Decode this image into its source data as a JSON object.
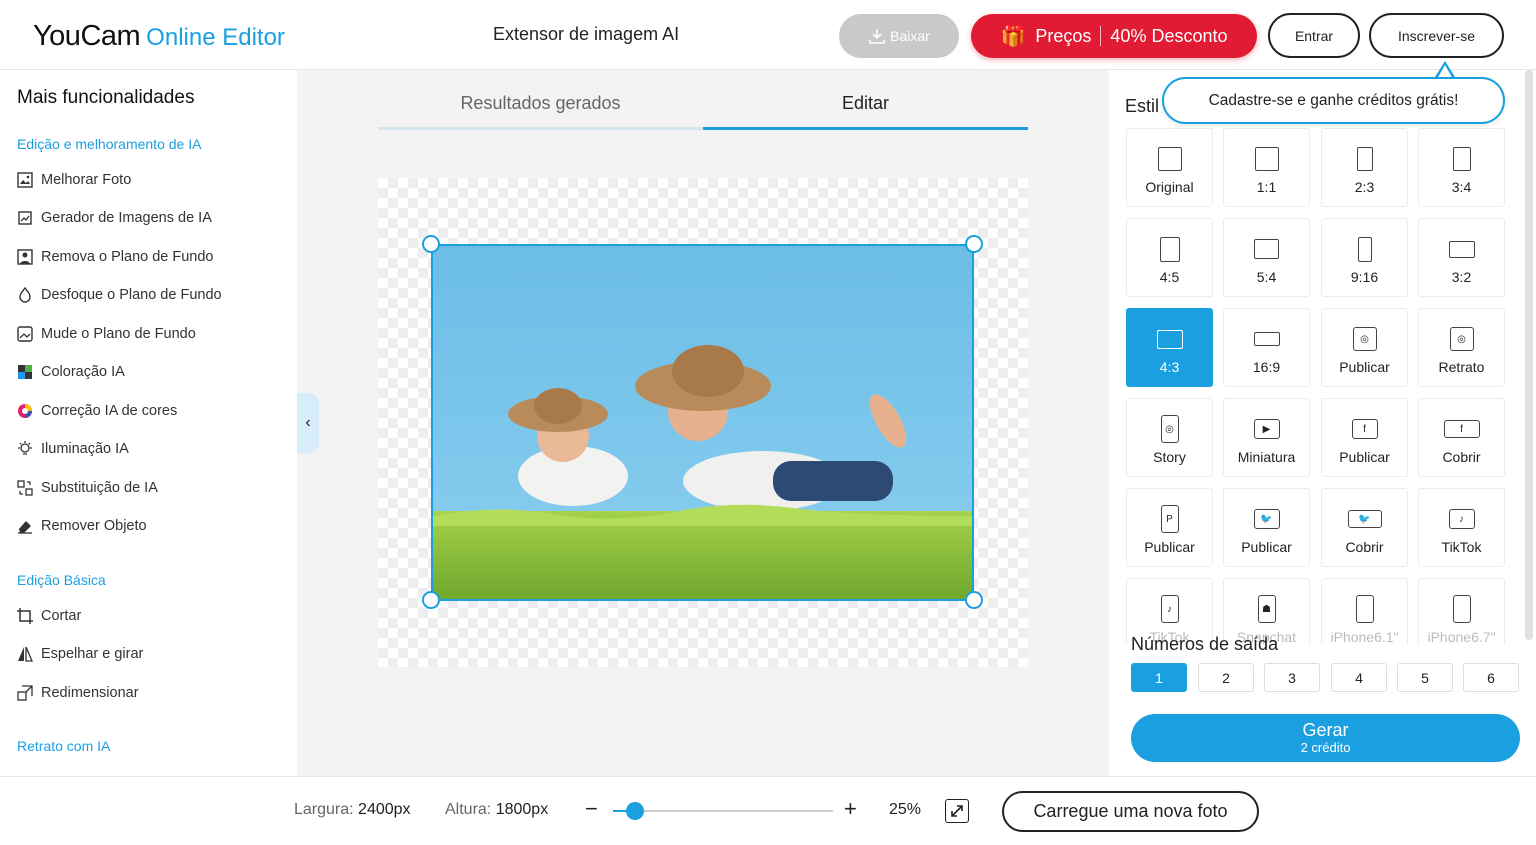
{
  "header": {
    "brand": "YouCam",
    "brand_sub": "Online Editor",
    "title": "Extensor de imagem AI",
    "download_label": "Baixar",
    "prices_label": "Preços",
    "discount_label": "40% Desconto",
    "login_label": "Entrar",
    "signup_label": "Inscrever-se"
  },
  "tooltip": {
    "text": "Cadastre-se e ganhe créditos grátis!"
  },
  "sidebar": {
    "title": "Mais funcionalidades",
    "section_ai": "Edição e melhoramento de IA",
    "ai_items": [
      "Melhorar Foto",
      "Gerador de Imagens de IA",
      "Remova o Plano de Fundo",
      "Desfoque o Plano de Fundo",
      "Mude o Plano de Fundo",
      "Coloração IA",
      "Correção IA de cores",
      "Iluminação IA",
      "Substituição de IA",
      "Remover Objeto"
    ],
    "section_basic": "Edição Básica",
    "basic_items": [
      "Cortar",
      "Espelhar e girar",
      "Redimensionar"
    ],
    "section_portrait": "Retrato com IA"
  },
  "tabs": {
    "results": "Resultados gerados",
    "edit": "Editar"
  },
  "right_panel": {
    "style_label": "Estil",
    "ratios": [
      "Original",
      "1:1",
      "2:3",
      "3:4",
      "4:5",
      "5:4",
      "9:16",
      "3:2",
      "4:3",
      "16:9",
      "Publicar",
      "Retrato",
      "Story",
      "Miniatura",
      "Publicar",
      "Cobrir",
      "Publicar",
      "Publicar",
      "Cobrir",
      "TikTok",
      "TikTok",
      "Snapchat",
      "iPhone6.1\"",
      "iPhone6.7\""
    ],
    "active_ratio": "4:3",
    "outputs_label": "Números de saída",
    "outputs": [
      "1",
      "2",
      "3",
      "4",
      "5",
      "6"
    ],
    "active_output": "1",
    "generate_label": "Gerar",
    "generate_credit": "2 crédito"
  },
  "bottom": {
    "width_label": "Largura:",
    "width_value": "2400px",
    "height_label": "Altura:",
    "height_value": "1800px",
    "zoom": "25%",
    "upload_label": "Carregue uma nova foto"
  },
  "colors": {
    "accent": "#1aa0e0",
    "promo": "#e11b34"
  }
}
